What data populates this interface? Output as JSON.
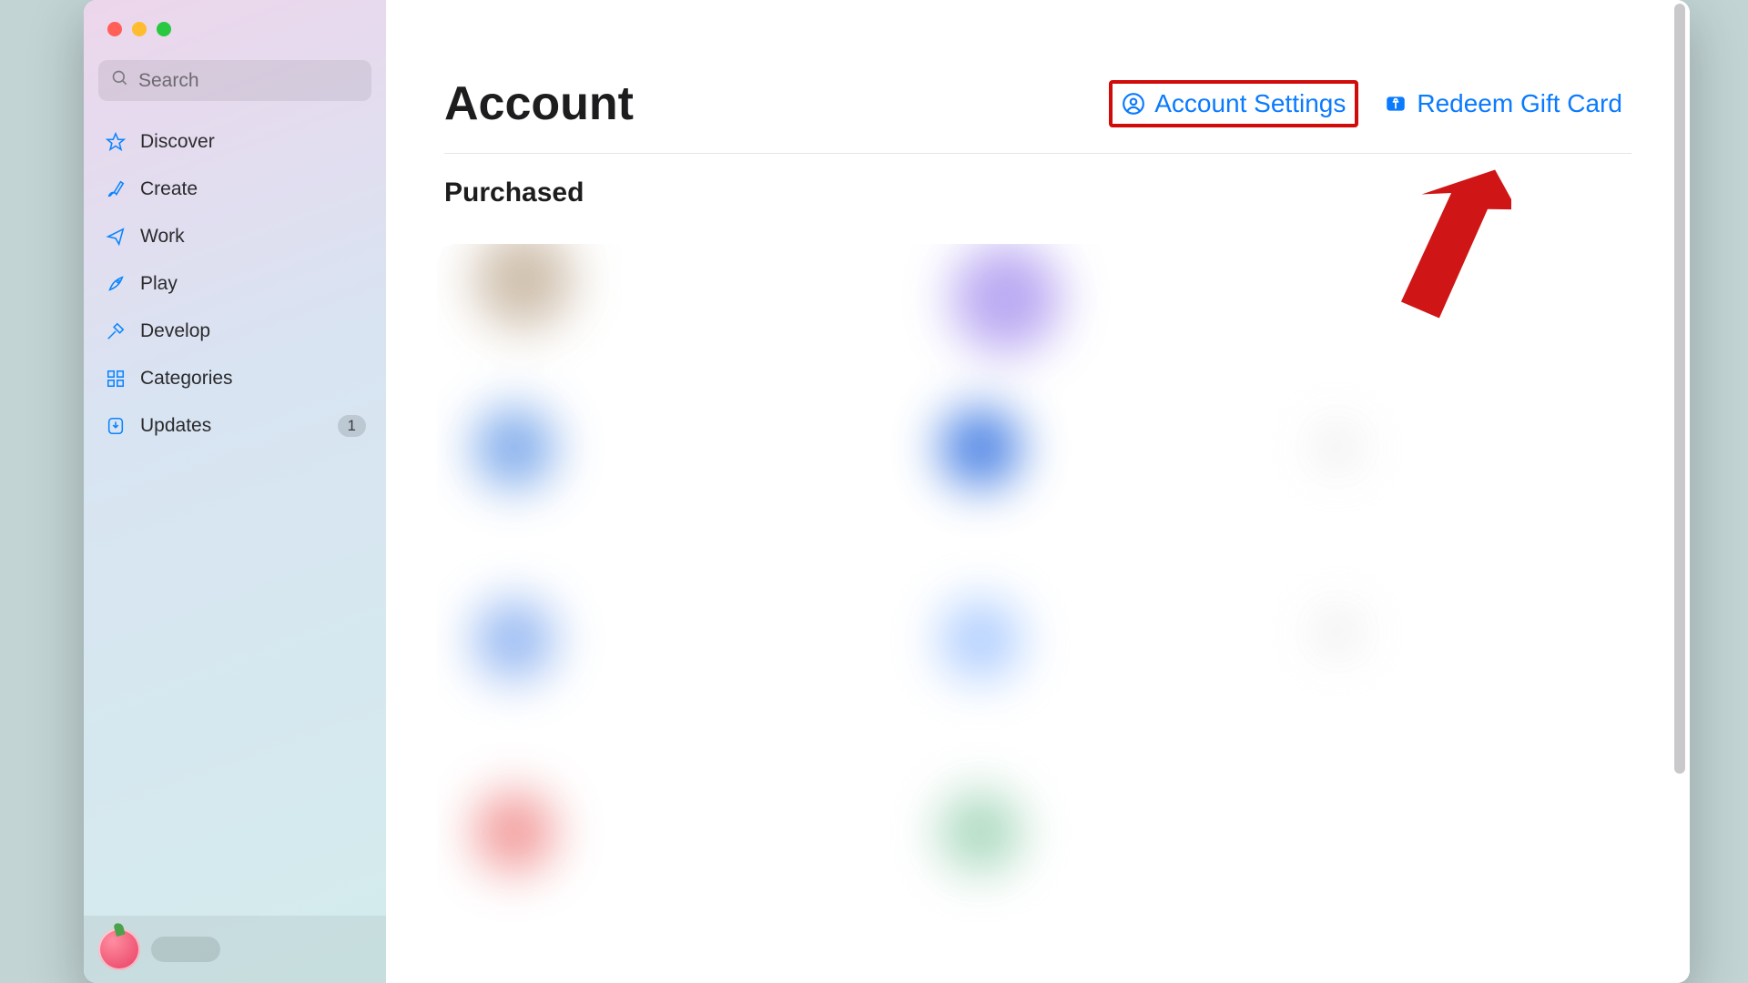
{
  "search": {
    "placeholder": "Search"
  },
  "sidebar": {
    "items": [
      {
        "label": "Discover",
        "icon": "star-icon"
      },
      {
        "label": "Create",
        "icon": "brush-icon"
      },
      {
        "label": "Work",
        "icon": "paperplane-icon"
      },
      {
        "label": "Play",
        "icon": "rocket-icon"
      },
      {
        "label": "Develop",
        "icon": "hammer-icon"
      },
      {
        "label": "Categories",
        "icon": "grid-icon"
      },
      {
        "label": "Updates",
        "icon": "download-icon",
        "badge": "1"
      }
    ]
  },
  "header": {
    "title": "Account",
    "account_settings_label": "Account Settings",
    "redeem_label": "Redeem Gift Card"
  },
  "section": {
    "purchased_title": "Purchased"
  }
}
